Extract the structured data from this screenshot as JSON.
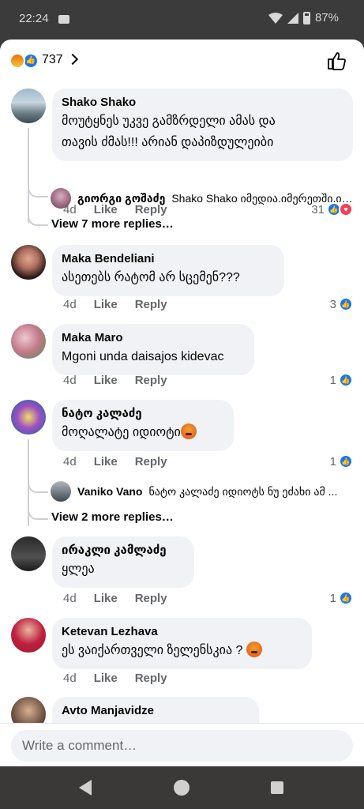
{
  "status_bar": {
    "time": "22:24",
    "battery": "87%"
  },
  "header": {
    "reaction_count": "737"
  },
  "comments": [
    {
      "author": "Shako Shako",
      "text_line1": "მოუტყნეს უკვე გამზრდელი ამას და",
      "text_line2": "თავის ძმას!!! არიან დაპიზდულეიბი",
      "time": "4d",
      "like": "Like",
      "reply": "Reply",
      "reactions": "31",
      "reply_preview": {
        "author": "გიორგი გოშაძე",
        "text": "Shako Shako იმედია.იმერეთში.იყოს ..."
      },
      "more_replies": "View 7 more replies…"
    },
    {
      "author": "Maka Bendeliani",
      "text": "ასეთებს რატომ არ სცემენ???",
      "time": "4d",
      "like": "Like",
      "reply": "Reply",
      "reactions": "3"
    },
    {
      "author": "Maka Maro",
      "text": "Mgoni unda daisajos kidevac",
      "time": "4d",
      "like": "Like",
      "reply": "Reply",
      "reactions": "1"
    },
    {
      "author": "ნატო კალაძე",
      "text": "მოღალატე იდიოტი",
      "time": "4d",
      "like": "Like",
      "reply": "Reply",
      "reactions": "1",
      "reply_preview": {
        "author": "Vaniko Vano",
        "text": "ნატო კალაძე იდიოტს ნუ ეძახი ამ ..."
      },
      "more_replies": "View 2 more replies…"
    },
    {
      "author": "ირაკლი კამლაძე",
      "text": "ყლეა",
      "time": "4d",
      "like": "Like",
      "reply": "Reply",
      "reactions": "1"
    },
    {
      "author": "Ketevan Lezhava",
      "text": "ეს ვაიქართველი ზელენსკია ?",
      "time": "4d",
      "like": "Like",
      "reply": "Reply"
    },
    {
      "author": "Avto Manjavidze"
    }
  ],
  "composer": {
    "placeholder": "Write a comment…"
  },
  "colors": {
    "accent": "#1877f2",
    "bubble": "#f0f2f5",
    "meta": "#65676b"
  }
}
